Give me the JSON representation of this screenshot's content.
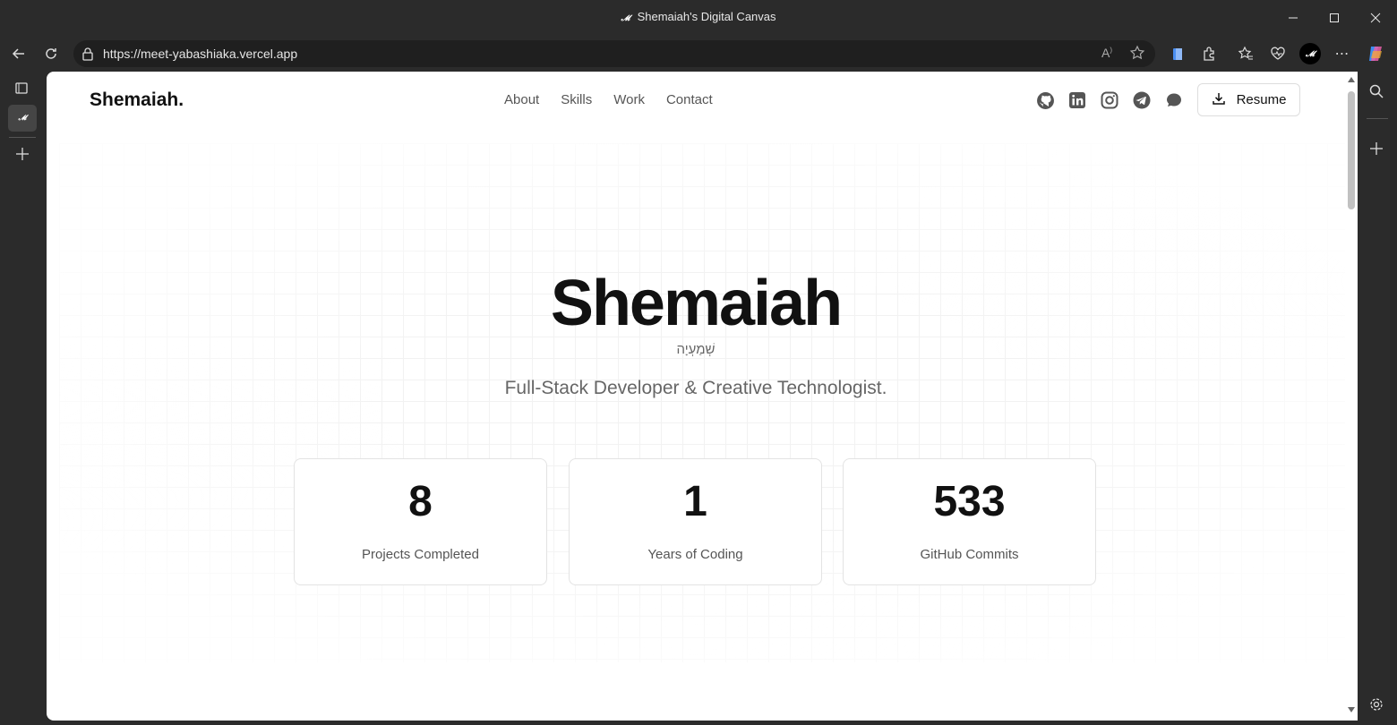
{
  "window": {
    "title": "Shemaiah's Digital Canvas",
    "favicon": "𝓜"
  },
  "browser": {
    "url": "https://meet-yabashiaka.vercel.app"
  },
  "site": {
    "logo": "Shemaiah.",
    "nav": [
      "About",
      "Skills",
      "Work",
      "Contact"
    ],
    "socials": [
      "github-icon",
      "linkedin-icon",
      "instagram-icon",
      "telegram-icon",
      "chat-icon"
    ],
    "resume_label": "Resume"
  },
  "hero": {
    "name": "Shemaiah",
    "hebrew": "שְׁמַעְיָה",
    "subtitle": "Full-Stack Developer & Creative Technologist."
  },
  "stats": [
    {
      "value": "8",
      "label": "Projects Completed"
    },
    {
      "value": "1",
      "label": "Years of Coding"
    },
    {
      "value": "533",
      "label": "GitHub Commits"
    }
  ]
}
